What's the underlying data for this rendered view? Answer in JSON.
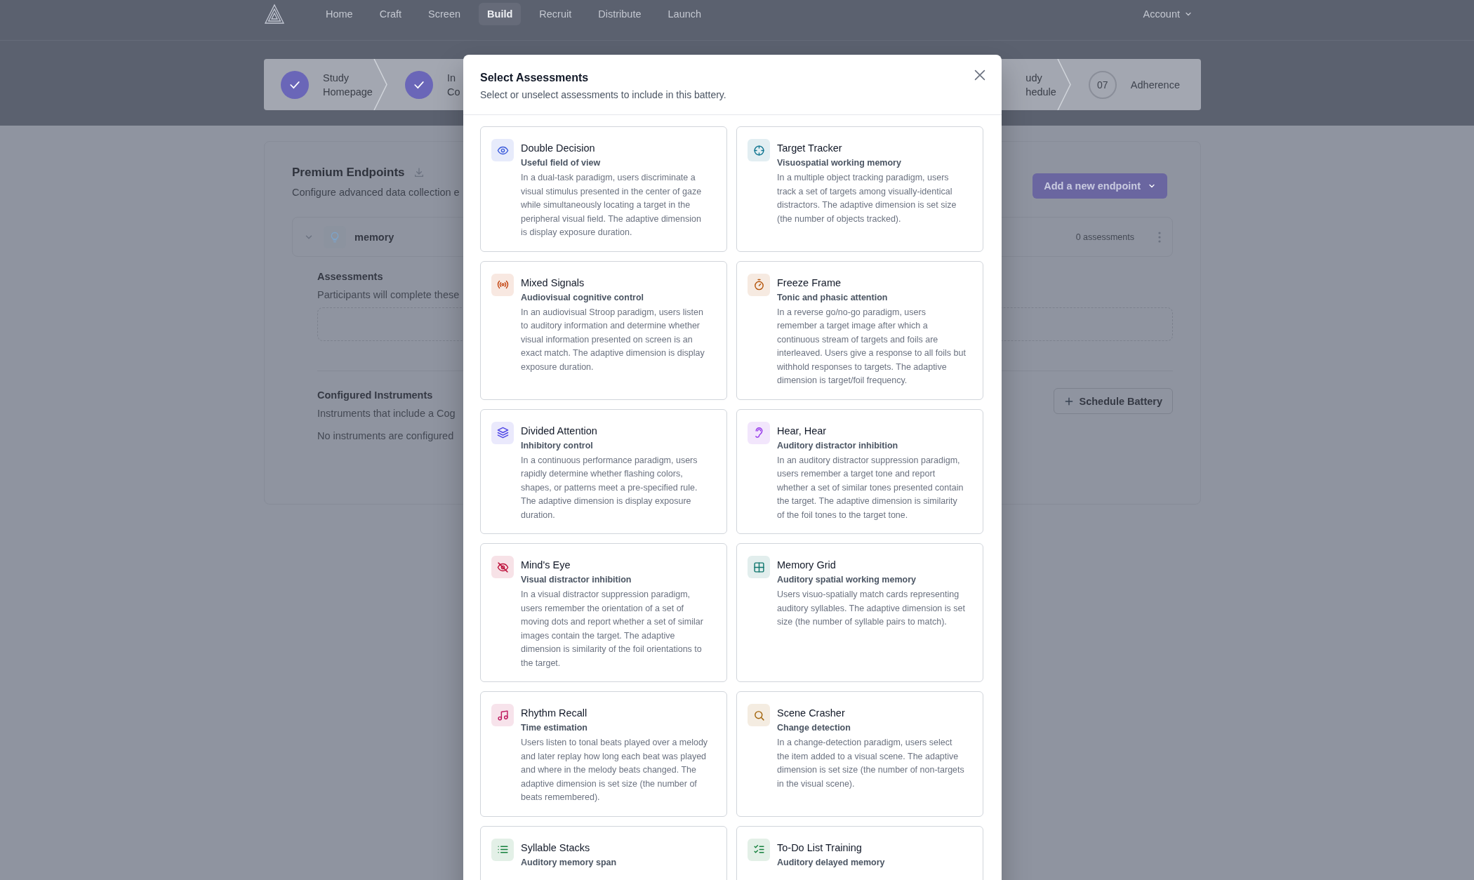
{
  "nav": {
    "items": [
      {
        "label": "Home",
        "selected": false
      },
      {
        "label": "Craft",
        "selected": false
      },
      {
        "label": "Screen",
        "selected": false
      },
      {
        "label": "Build",
        "selected": true
      },
      {
        "label": "Recruit",
        "selected": false
      },
      {
        "label": "Distribute",
        "selected": false
      },
      {
        "label": "Launch",
        "selected": false
      }
    ],
    "account": "Account"
  },
  "stepper": {
    "left": [
      {
        "lines": [
          "Study",
          "Homepage"
        ],
        "done": true
      },
      {
        "lines": [
          "In",
          "Co"
        ],
        "done": true
      }
    ],
    "right": [
      {
        "lines": [
          "udy",
          "hedule"
        ]
      },
      {
        "number": "07",
        "lines": [
          "Adherence"
        ],
        "done": false
      }
    ]
  },
  "endpoints": {
    "title": "Premium Endpoints",
    "subtitle": "Configure advanced data collection e",
    "add_button": "Add a new endpoint",
    "group": {
      "name": "memory",
      "expanded": true,
      "count": "0 assessments"
    },
    "assessments_title": "Assessments",
    "assessments_text": "Participants will complete these",
    "instruments_title": "Configured Instruments",
    "instruments_text": "Instruments that include a Cog",
    "instruments_empty": "No instruments are configured",
    "schedule_button": "Schedule Battery"
  },
  "modal": {
    "title": "Select Assessments",
    "subtitle": "Select or unselect assessments to include in this battery.",
    "cards": [
      {
        "kind": "eye",
        "color": "#3b5bdb",
        "title": "Double Decision",
        "subtitle": "Useful field of view",
        "description": "In a dual-task paradigm, users discriminate a visual stimulus presented in the center of gaze while simultaneously locating a target in the peripheral visual field. The adaptive dimension is display exposure duration."
      },
      {
        "kind": "crosshair",
        "color": "#0e7490",
        "title": "Target Tracker",
        "subtitle": "Visuospatial working memory",
        "description": "In a multiple object tracking paradigm, users track a set of targets among visually-identical distractors. The adaptive dimension is set size (the number of objects tracked)."
      },
      {
        "kind": "signal",
        "color": "#c2410c",
        "title": "Mixed Signals",
        "subtitle": "Audiovisual cognitive control",
        "description": "In an audiovisual Stroop paradigm, users listen to auditory information and determine whether visual information presented on screen is an exact match. The adaptive dimension is display exposure duration."
      },
      {
        "kind": "timer",
        "color": "#b45309",
        "title": "Freeze Frame",
        "subtitle": "Tonic and phasic attention",
        "description": "In a reverse go/no-go paradigm, users remember a target image after which a continuous stream of targets and foils are interleaved. Users give a response to all foils but withhold responses to targets. The adaptive dimension is target/foil frequency."
      },
      {
        "kind": "layers",
        "color": "#4f46e5",
        "title": "Divided Attention",
        "subtitle": "Inhibitory control",
        "description": "In a continuous performance paradigm, users rapidly determine whether flashing colors, shapes, or patterns meet a pre-specified rule. The adaptive dimension is display exposure duration."
      },
      {
        "kind": "ear",
        "color": "#9333ea",
        "title": "Hear, Hear",
        "subtitle": "Auditory distractor inhibition",
        "description": "In an auditory distractor suppression paradigm, users remember a target tone and report whether a set of similar tones presented contain the target. The adaptive dimension is similarity of the foil tones to the target tone."
      },
      {
        "kind": "eye-off",
        "color": "#be123c",
        "title": "Mind's Eye",
        "subtitle": "Visual distractor inhibition",
        "description": "In a visual distractor suppression paradigm, users remember the orientation of a set of moving dots and report whether a set of similar images contain the target. The adaptive dimension is similarity of the foil orientations to the target."
      },
      {
        "kind": "grid",
        "color": "#0f766e",
        "title": "Memory Grid",
        "subtitle": "Auditory spatial working memory",
        "description": "Users visuo-spatially match cards representing auditory syllables. The adaptive dimension is set size (the number of syllable pairs to match)."
      },
      {
        "kind": "music",
        "color": "#be185d",
        "title": "Rhythm Recall",
        "subtitle": "Time estimation",
        "description": "Users listen to tonal beats played over a melody and later replay how long each beat was played and where in the melody beats changed. The adaptive dimension is set size (the number of beats remembered)."
      },
      {
        "kind": "search",
        "color": "#a16207",
        "title": "Scene Crasher",
        "subtitle": "Change detection",
        "description": "In a change-detection paradigm, users select the item added to a visual scene. The adaptive dimension is set size (the number of non-targets in the visual scene)."
      },
      {
        "kind": "list",
        "color": "#15803d",
        "title": "Syllable Stacks",
        "subtitle": "Auditory memory span"
      },
      {
        "kind": "list-check",
        "color": "#15803d",
        "title": "To-Do List Training",
        "subtitle": "Auditory delayed memory"
      }
    ]
  }
}
